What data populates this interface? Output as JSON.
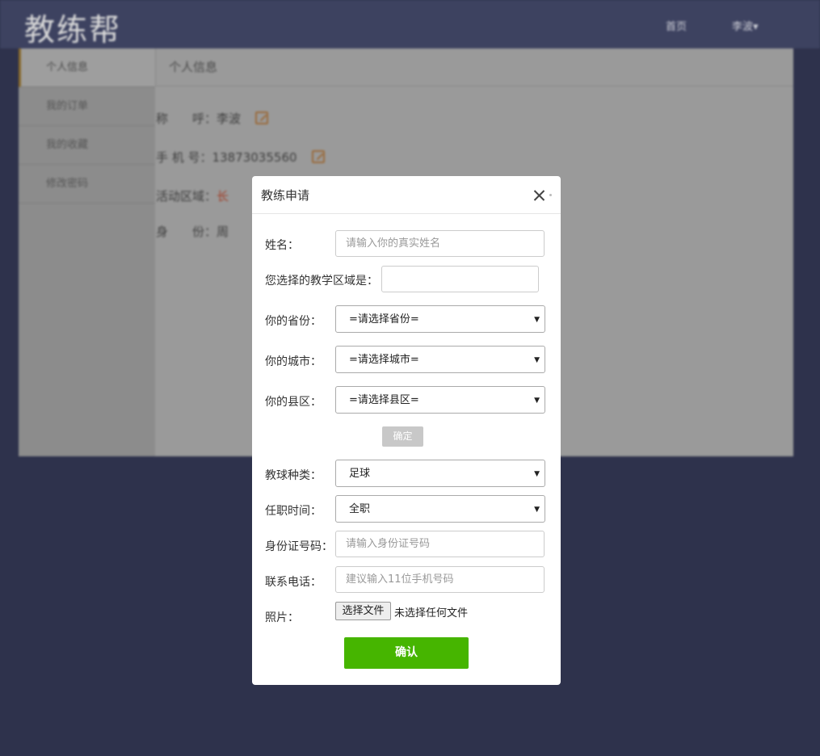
{
  "header": {
    "logo": "教练帮",
    "nav_home": "首页",
    "nav_user": "李波▾"
  },
  "sidebar": {
    "items": [
      {
        "label": "个人信息"
      },
      {
        "label": "我的订单"
      },
      {
        "label": "我的收藏"
      },
      {
        "label": "修改密码"
      }
    ]
  },
  "content": {
    "title": "个人信息",
    "rows": [
      {
        "label": "称　　呼：",
        "value": "李波"
      },
      {
        "label": "手 机 号：",
        "value": "13873035560"
      },
      {
        "label": "活动区域：",
        "value": "长"
      },
      {
        "label": "身　　份：",
        "value": "周"
      }
    ]
  },
  "modal": {
    "title": "教练申请",
    "name": {
      "label": "姓名：",
      "placeholder": "请输入你的真实姓名"
    },
    "region": {
      "label": "您选择的教学区域是：",
      "value": ""
    },
    "province": {
      "label": "你的省份：",
      "value": "=请选择省份="
    },
    "city": {
      "label": "你的城市：",
      "value": "=请选择城市="
    },
    "county": {
      "label": "你的县区：",
      "value": "=请选择县区="
    },
    "confirm_small": "确定",
    "sport": {
      "label": "教球种类：",
      "value": "足球"
    },
    "employment": {
      "label": "任职时间：",
      "value": "全职"
    },
    "idcard": {
      "label": "身份证号码：",
      "placeholder": "请输入身份证号码"
    },
    "phone": {
      "label": "联系电话：",
      "placeholder": "建议输入11位手机号码"
    },
    "photo": {
      "label": "照片：",
      "button": "选择文件",
      "status": "未选择任何文件"
    },
    "submit": "确认"
  }
}
